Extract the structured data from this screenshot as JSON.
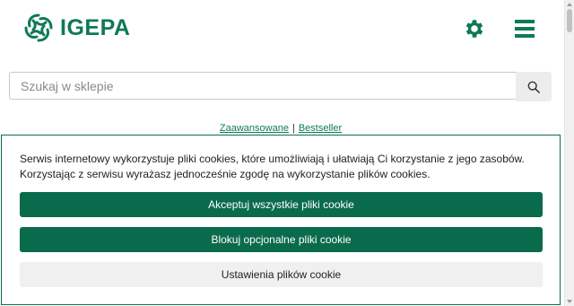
{
  "brand": {
    "name": "IGEPA",
    "color": "#0d7a55"
  },
  "header": {
    "settings_icon": "gear-icon",
    "menu_icon": "hamburger-menu-icon"
  },
  "search": {
    "placeholder": "Szukaj w sklepie",
    "value": "",
    "button_icon": "search-icon"
  },
  "links": {
    "advanced": "Zaawansowane",
    "separator": "|",
    "bestseller": "Bestseller"
  },
  "cookie": {
    "line1": "Serwis internetowy wykorzystuje pliki cookies, które umożliwiają i ułatwiają Ci korzystanie z jego zasobów.",
    "line2": "Korzystając z serwisu wyrażasz jednocześnie zgodę na wykorzystanie plików cookies.",
    "accept_all": "Akceptuj wszystkie pliki cookie",
    "block_optional": "Blokuj opcjonalne pliki cookie",
    "settings": "Ustawienia plików cookie",
    "primary_color": "#0a6b4c"
  }
}
